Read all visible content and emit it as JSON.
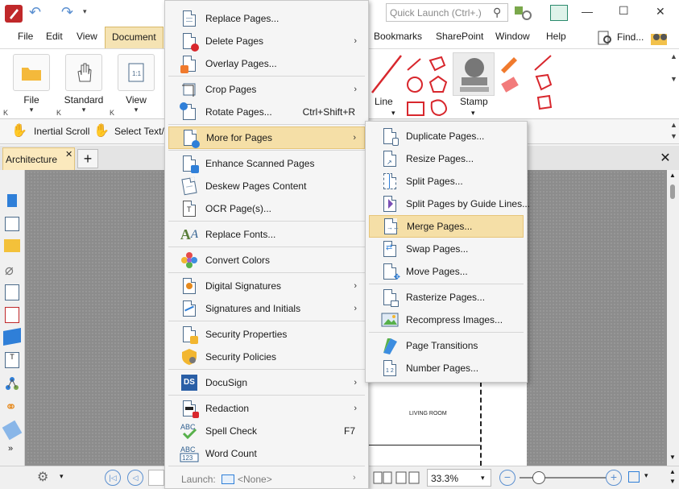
{
  "window": {
    "search_placeholder": "Quick Launch (Ctrl+.)",
    "find_label": "Find...",
    "controls": {
      "minimize": "—",
      "maximize": "☐",
      "close": "✕"
    }
  },
  "menu_tabs": [
    "File",
    "Edit",
    "View",
    "Document",
    "Bookmarks",
    "SharePoint",
    "Window",
    "Help"
  ],
  "ribbon": {
    "file": "File",
    "standard": "Standard",
    "view": "View",
    "line": "Line",
    "stamp": "Stamp"
  },
  "quickbar": {
    "inertial_scroll": "Inertial Scroll",
    "select_text": "Select Text/I"
  },
  "document_tab": {
    "title": "Architecture"
  },
  "canvas": {
    "room_label": "LIVING ROOM"
  },
  "status": {
    "zoom": "33.3%"
  },
  "main_menu": {
    "items": [
      {
        "label": "Replace Pages...",
        "icon": "replace-pages-icon"
      },
      {
        "label": "Delete Pages",
        "icon": "delete-pages-icon",
        "arrow": "›"
      },
      {
        "label": "Overlay Pages...",
        "icon": "overlay-pages-icon"
      },
      {
        "label": "Crop Pages",
        "icon": "crop-pages-icon",
        "arrow": "›"
      },
      {
        "label": "Rotate Pages...",
        "icon": "rotate-pages-icon",
        "shortcut": "Ctrl+Shift+R"
      },
      {
        "label": "More for Pages",
        "icon": "more-pages-icon",
        "arrow": "›"
      },
      {
        "label": "Enhance Scanned Pages",
        "icon": "enhance-scan-icon"
      },
      {
        "label": "Deskew Pages Content",
        "icon": "deskew-icon"
      },
      {
        "label": "OCR Page(s)...",
        "icon": "ocr-icon"
      },
      {
        "label": "Replace Fonts...",
        "icon": "replace-fonts-icon"
      },
      {
        "label": "Convert Colors",
        "icon": "convert-colors-icon"
      },
      {
        "label": "Digital Signatures",
        "icon": "digital-signature-icon",
        "arrow": "›"
      },
      {
        "label": "Signatures and Initials",
        "icon": "signatures-icon",
        "arrow": "›"
      },
      {
        "label": "Security Properties",
        "icon": "security-properties-icon"
      },
      {
        "label": "Security Policies",
        "icon": "security-policies-icon"
      },
      {
        "label": "DocuSign",
        "icon": "docusign-icon",
        "arrow": "›"
      },
      {
        "label": "Redaction",
        "icon": "redaction-icon",
        "arrow": "›"
      },
      {
        "label": "Spell Check",
        "icon": "spell-check-icon",
        "shortcut": "F7"
      },
      {
        "label": "Word Count",
        "icon": "word-count-icon"
      }
    ],
    "launch_label": "Launch:",
    "launch_value": "<None>"
  },
  "sub_menu": {
    "items": [
      {
        "label": "Duplicate Pages...",
        "icon": "duplicate-pages-icon"
      },
      {
        "label": "Resize Pages...",
        "icon": "resize-pages-icon"
      },
      {
        "label": "Split Pages...",
        "icon": "split-pages-icon"
      },
      {
        "label": "Split Pages by Guide Lines...",
        "icon": "split-guides-icon"
      },
      {
        "label": "Merge Pages...",
        "icon": "merge-pages-icon"
      },
      {
        "label": "Swap Pages...",
        "icon": "swap-pages-icon"
      },
      {
        "label": "Move Pages...",
        "icon": "move-pages-icon"
      },
      {
        "label": "Rasterize Pages...",
        "icon": "rasterize-pages-icon"
      },
      {
        "label": "Recompress Images...",
        "icon": "recompress-images-icon"
      },
      {
        "label": "Page Transitions",
        "icon": "page-transitions-icon"
      },
      {
        "label": "Number Pages...",
        "icon": "number-pages-icon"
      }
    ]
  },
  "colors": {
    "accent": "#f5dfa7",
    "highlight_border": "#e6c57a",
    "brand_red": "#c0282a"
  }
}
